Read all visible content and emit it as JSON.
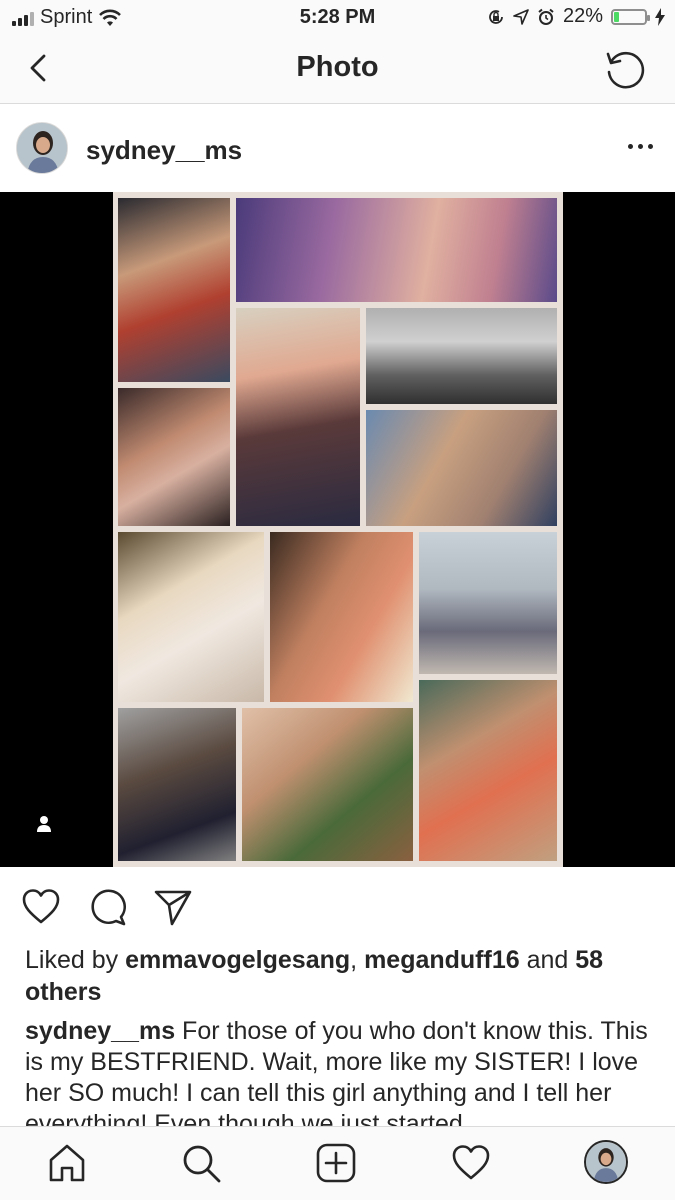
{
  "status_bar": {
    "carrier": "Sprint",
    "time": "5:28 PM",
    "battery_percent": "22%",
    "battery_level": 0.22,
    "icons": [
      "signal-bars-icon",
      "wifi-icon",
      "screen-lock-icon",
      "location-arrow-icon",
      "alarm-icon",
      "battery-icon",
      "charging-bolt-icon"
    ]
  },
  "nav": {
    "title": "Photo",
    "back_icon": "chevron-left-icon",
    "refresh_icon": "refresh-icon"
  },
  "post": {
    "username": "sydney__ms",
    "more_icon": "more-horizontal-icon",
    "photo_tag_icon": "person-tag-icon",
    "actions": [
      "heart-icon",
      "comment-icon",
      "share-icon"
    ],
    "likes": {
      "prefix": "Liked by ",
      "user1": "emmavogelgesang",
      "sep": ", ",
      "user2": "meganduff16",
      "and": " and ",
      "others": "58 others"
    },
    "caption": {
      "username": "sydney__ms",
      "text": " For those of you who don't know this. This is my BESTFRIEND. Wait, more like my SISTER! I love her SO much! I can tell this girl anything and I tell her everything! Even though we just started"
    }
  },
  "tab_bar": {
    "icons": [
      "home-icon",
      "search-icon",
      "new-post-icon",
      "activity-heart-icon",
      "profile-avatar"
    ]
  },
  "colors": {
    "text": "#262626",
    "bar_background": "#fafafa",
    "divider": "#dbdbdb",
    "battery_green": "#4cd964",
    "photo_background": "#000000"
  }
}
